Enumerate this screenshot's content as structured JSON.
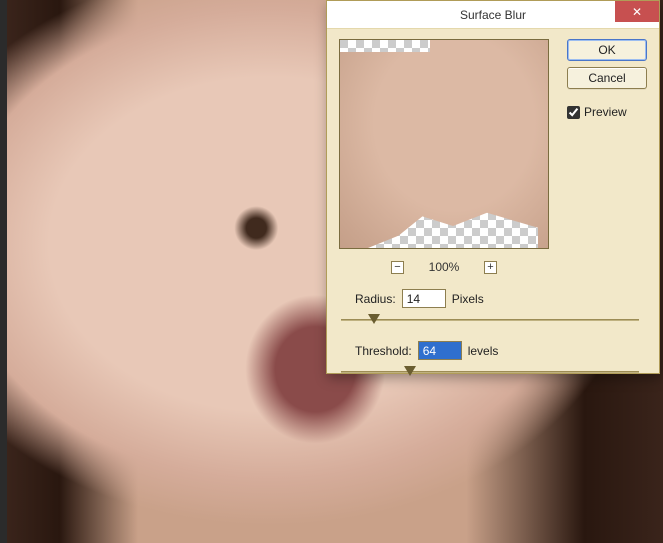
{
  "dialog": {
    "title": "Surface Blur",
    "buttons": {
      "ok": "OK",
      "cancel": "Cancel"
    },
    "preview_checkbox": {
      "label": "Preview",
      "checked": true
    },
    "zoom": {
      "percent": "100%",
      "minus_icon": "−",
      "plus_icon": "+"
    },
    "close_icon": "✕"
  },
  "params": {
    "radius": {
      "label": "Radius:",
      "value": "14",
      "unit": "Pixels",
      "slider_percent": 11
    },
    "threshold": {
      "label": "Threshold:",
      "value": "64",
      "unit": "levels",
      "slider_percent": 23
    }
  }
}
